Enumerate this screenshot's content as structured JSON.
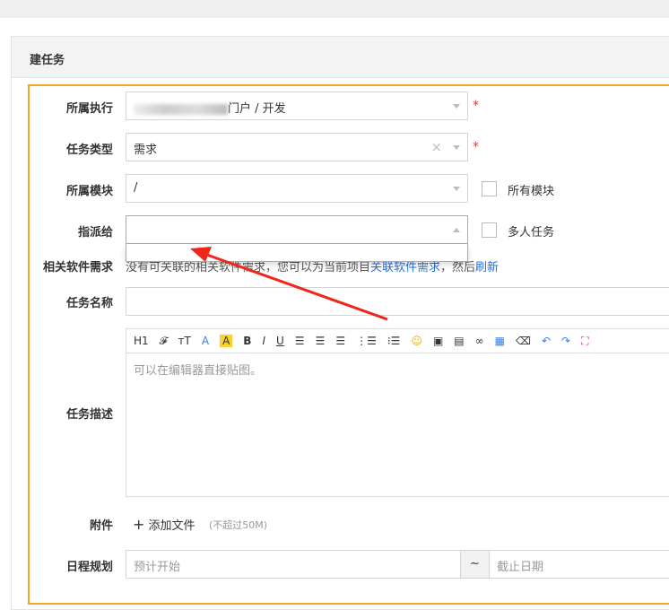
{
  "panel_title": "建任务",
  "fields": {
    "execution": {
      "label": "所属执行",
      "value": "门户 / 开发"
    },
    "type": {
      "label": "任务类型",
      "value": "需求",
      "clear": "×"
    },
    "module": {
      "label": "所属模块",
      "value": "/",
      "checkbox_label": "所有模块"
    },
    "assign": {
      "label": "指派给",
      "value": "",
      "checkbox_label": "多人任务"
    },
    "story": {
      "label": "相关软件需求",
      "text_prefix": "没有可关联的相关软件需求，您可以为当前项目",
      "link1": "关联软件需求",
      "text_mid": "，然后",
      "link2": "刷新"
    },
    "name": {
      "label": "任务名称",
      "value": ""
    },
    "desc": {
      "label": "任务描述",
      "placeholder": "可以在编辑器直接贴图。"
    },
    "files": {
      "label": "附件",
      "button": "添加文件",
      "hint": "(不超过50M)"
    },
    "schedule": {
      "label": "日程规划",
      "start_placeholder": "预计开始",
      "separator": "~",
      "end_placeholder": "截止日期"
    }
  },
  "required_mark": "*",
  "toolbar": [
    "H1",
    "𝓕",
    "тT",
    "A",
    "A",
    "B",
    "I",
    "U"
  ]
}
